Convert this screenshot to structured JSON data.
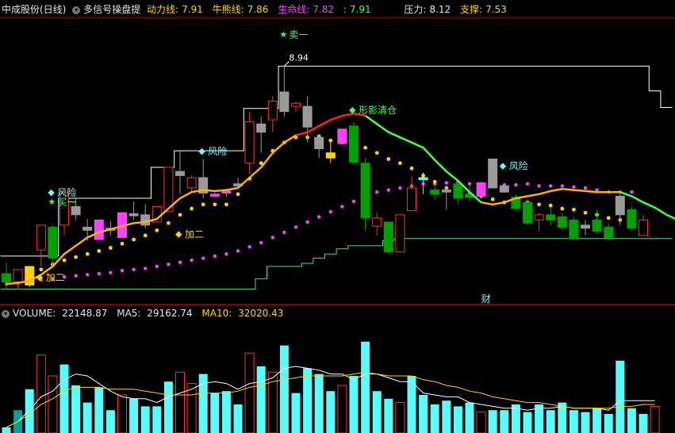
{
  "header": {
    "stock": "中成股份(日线)",
    "indicator": "多信号操盘提",
    "items": [
      {
        "label": "动力线:",
        "value": "7.91",
        "color": "#ffd400"
      },
      {
        "label": "牛熊线:",
        "value": "7.86",
        "color": "#ffd400"
      },
      {
        "label": "生命线:",
        "value": "7.82",
        "color": "#ff40ff"
      },
      {
        "label": ":",
        "value": "7.91",
        "color": "#44ff44"
      },
      {
        "label": "压力:",
        "value": "8.12",
        "color": "#e6e6e6"
      },
      {
        "label": "支撑:",
        "value": "7.53",
        "color": "#ffd400"
      }
    ]
  },
  "volume_header": {
    "label": "VOLUME:",
    "value": "22148.87",
    "ma5_label": "MA5:",
    "ma5": "29162.74",
    "ma10_label": "MA10:",
    "ma10": "32020.43"
  },
  "colors": {
    "up": "#ff3030",
    "down": "#00a000",
    "grey": "#9a9a9a",
    "magenta": "#ff40ff",
    "yellow": "#ffd400",
    "green": "#44ff44",
    "cyan": "#55ffff",
    "red": "#ff2020",
    "white": "#ffffff",
    "support": "#40e080",
    "divider": "#b00000"
  },
  "chart_data": [
    {
      "type": "candlestick",
      "ylim": [
        6.7,
        9.35
      ],
      "max_label": "8.94",
      "candles": [
        {
          "o": 6.93,
          "h": 7.04,
          "l": 6.78,
          "c": 6.85,
          "k": "down"
        },
        {
          "o": 6.85,
          "h": 6.97,
          "l": 6.78,
          "c": 6.97,
          "k": "up"
        },
        {
          "o": 6.82,
          "h": 7.0,
          "l": 6.8,
          "c": 7.0,
          "k": "yellow"
        },
        {
          "o": 7.16,
          "h": 7.4,
          "l": 7.0,
          "c": 7.4,
          "k": "up"
        },
        {
          "o": 7.38,
          "h": 7.4,
          "l": 7.0,
          "c": 7.08,
          "k": "down"
        },
        {
          "o": 7.4,
          "h": 7.72,
          "l": 7.3,
          "c": 7.72,
          "k": "up"
        },
        {
          "o": 7.58,
          "h": 7.66,
          "l": 7.45,
          "c": 7.5,
          "k": "grey"
        },
        {
          "o": 7.35,
          "h": 7.46,
          "l": 7.25,
          "c": 7.38,
          "k": "grey"
        },
        {
          "o": 7.26,
          "h": 7.45,
          "l": 7.26,
          "c": 7.45,
          "k": "magenta"
        },
        {
          "o": 7.35,
          "h": 7.44,
          "l": 7.3,
          "c": 7.37,
          "k": "grey"
        },
        {
          "o": 7.28,
          "h": 7.52,
          "l": 7.28,
          "c": 7.52,
          "k": "magenta"
        },
        {
          "o": 7.51,
          "h": 7.63,
          "l": 7.45,
          "c": 7.49,
          "k": "grey"
        },
        {
          "o": 7.5,
          "h": 7.6,
          "l": 7.37,
          "c": 7.4,
          "k": "grey"
        },
        {
          "o": 7.43,
          "h": 7.58,
          "l": 7.43,
          "c": 7.58,
          "k": "up"
        },
        {
          "o": 7.53,
          "h": 7.96,
          "l": 7.53,
          "c": 7.96,
          "k": "up"
        },
        {
          "o": 7.88,
          "h": 8.12,
          "l": 7.7,
          "c": 7.92,
          "k": "grey"
        },
        {
          "o": 7.76,
          "h": 7.88,
          "l": 7.73,
          "c": 7.86,
          "k": "up"
        },
        {
          "o": 7.86,
          "h": 8.04,
          "l": 7.66,
          "c": 7.71,
          "k": "grey"
        },
        {
          "o": 7.68,
          "h": 7.72,
          "l": 7.67,
          "c": 7.7,
          "k": "magenta"
        },
        {
          "o": 7.71,
          "h": 7.74,
          "l": 7.67,
          "c": 7.73,
          "k": "magenta"
        },
        {
          "o": 7.8,
          "h": 7.86,
          "l": 7.75,
          "c": 7.78,
          "k": "grey"
        },
        {
          "o": 8.0,
          "h": 8.5,
          "l": 7.9,
          "c": 8.4,
          "k": "up"
        },
        {
          "o": 8.3,
          "h": 8.45,
          "l": 8.1,
          "c": 8.38,
          "k": "grey"
        },
        {
          "o": 8.42,
          "h": 8.65,
          "l": 8.3,
          "c": 8.6,
          "k": "up"
        },
        {
          "o": 8.5,
          "h": 8.94,
          "l": 8.45,
          "c": 8.69,
          "k": "grey"
        },
        {
          "o": 8.55,
          "h": 8.6,
          "l": 8.5,
          "c": 8.58,
          "k": "up"
        },
        {
          "o": 8.55,
          "h": 8.65,
          "l": 8.2,
          "c": 8.35,
          "k": "grey"
        },
        {
          "o": 8.25,
          "h": 8.28,
          "l": 8.05,
          "c": 8.14,
          "k": "grey"
        },
        {
          "o": 8.1,
          "h": 8.22,
          "l": 8.0,
          "c": 8.05,
          "k": "yellow"
        },
        {
          "o": 8.19,
          "h": 8.33,
          "l": 8.19,
          "c": 8.33,
          "k": "magenta"
        },
        {
          "o": 8.36,
          "h": 8.4,
          "l": 7.99,
          "c": 8.01,
          "k": "down"
        },
        {
          "o": 8.0,
          "h": 8.05,
          "l": 7.35,
          "c": 7.47,
          "k": "down"
        },
        {
          "o": 7.39,
          "h": 7.52,
          "l": 7.3,
          "c": 7.47,
          "k": "up"
        },
        {
          "o": 7.43,
          "h": 7.43,
          "l": 7.12,
          "c": 7.14,
          "k": "down"
        },
        {
          "o": 7.14,
          "h": 7.5,
          "l": 7.14,
          "c": 7.5,
          "k": "up"
        },
        {
          "o": 7.54,
          "h": 7.87,
          "l": 7.54,
          "c": 7.76,
          "k": "up"
        },
        {
          "o": 7.84,
          "h": 7.91,
          "l": 7.7,
          "c": 7.86,
          "k": "cyan"
        },
        {
          "o": 7.74,
          "h": 7.78,
          "l": 7.65,
          "c": 7.7,
          "k": "down"
        },
        {
          "o": 7.74,
          "h": 7.78,
          "l": 7.55,
          "c": 7.72,
          "k": "grey"
        },
        {
          "o": 7.8,
          "h": 7.82,
          "l": 7.6,
          "c": 7.66,
          "k": "down"
        },
        {
          "o": 7.7,
          "h": 7.8,
          "l": 7.63,
          "c": 7.67,
          "k": "down"
        },
        {
          "o": 7.68,
          "h": 7.81,
          "l": 7.66,
          "c": 7.81,
          "k": "magenta"
        },
        {
          "o": 7.76,
          "h": 8.04,
          "l": 7.76,
          "c": 8.04,
          "k": "grey"
        },
        {
          "o": 7.78,
          "h": 7.78,
          "l": 7.72,
          "c": 7.72,
          "k": "grey"
        },
        {
          "o": 7.67,
          "h": 7.7,
          "l": 7.54,
          "c": 7.56,
          "k": "down"
        },
        {
          "o": 7.62,
          "h": 7.65,
          "l": 7.4,
          "c": 7.42,
          "k": "down"
        },
        {
          "o": 7.45,
          "h": 7.52,
          "l": 7.34,
          "c": 7.5,
          "k": "up"
        },
        {
          "o": 7.5,
          "h": 7.57,
          "l": 7.4,
          "c": 7.45,
          "k": "down"
        },
        {
          "o": 7.48,
          "h": 7.52,
          "l": 7.35,
          "c": 7.38,
          "k": "down"
        },
        {
          "o": 7.45,
          "h": 7.48,
          "l": 7.25,
          "c": 7.27,
          "k": "down"
        },
        {
          "o": 7.4,
          "h": 7.45,
          "l": 7.3,
          "c": 7.37,
          "k": "grey"
        },
        {
          "o": 7.45,
          "h": 7.55,
          "l": 7.32,
          "c": 7.34,
          "k": "down"
        },
        {
          "o": 7.38,
          "h": 7.42,
          "l": 7.25,
          "c": 7.28,
          "k": "down"
        },
        {
          "o": 7.5,
          "h": 7.7,
          "l": 7.4,
          "c": 7.68,
          "k": "grey"
        },
        {
          "o": 7.55,
          "h": 7.58,
          "l": 7.35,
          "c": 7.37,
          "k": "down"
        },
        {
          "o": 7.3,
          "h": 7.5,
          "l": 7.3,
          "c": 7.45,
          "k": "up"
        }
      ],
      "yellow_line": [
        6.83,
        6.84,
        6.86,
        6.92,
        7.0,
        7.12,
        7.2,
        7.28,
        7.33,
        7.36,
        7.39,
        7.42,
        7.43,
        7.46,
        7.56,
        7.66,
        7.72,
        7.74,
        7.73,
        7.74,
        7.76,
        7.86,
        7.96,
        8.1,
        8.2,
        8.27
      ],
      "red_line": [
        8.27,
        8.3,
        8.36,
        8.42,
        8.46,
        8.48,
        8.46
      ],
      "green_line": [
        8.46,
        8.38,
        8.3,
        8.25,
        8.2,
        8.15,
        8.03,
        7.92,
        7.83,
        7.72,
        7.62
      ],
      "yellow_line2": [
        7.62,
        7.6,
        7.62,
        7.66,
        7.68,
        7.7,
        7.73,
        7.75,
        7.74,
        7.73,
        7.72,
        7.72,
        7.72
      ],
      "green_line2": [
        7.72,
        7.68,
        7.62,
        7.57,
        7.5,
        7.45
      ],
      "yellow_line3": [
        7.45,
        7.44,
        7.44,
        7.42,
        7.4,
        7.4,
        7.39,
        7.4,
        7.38,
        7.4
      ],
      "yellow_dots": [
        6.86,
        6.88,
        6.92,
        6.97,
        7.02,
        7.06,
        7.09,
        7.12,
        7.15,
        7.18,
        7.22,
        7.26,
        7.3,
        7.35,
        7.42,
        7.5,
        7.56,
        7.6,
        7.6,
        7.6,
        7.7,
        7.85,
        8.0,
        8.12,
        8.2,
        8.25,
        8.25,
        8.26,
        8.22,
        8.2,
        8.2,
        8.15,
        8.1,
        8.04,
        8.0,
        7.95,
        7.88,
        7.82,
        7.76,
        7.72,
        7.7,
        7.68,
        7.65,
        7.62,
        7.6,
        7.62,
        7.6,
        7.59,
        7.56,
        7.55,
        7.52,
        7.5,
        7.47,
        7.45,
        7.42,
        7.38
      ],
      "magenta_dots": [
        6.83,
        6.84,
        6.85,
        6.87,
        6.88,
        6.9,
        6.91,
        6.92,
        6.93,
        6.94,
        6.96,
        6.97,
        6.98,
        7.0,
        7.02,
        7.04,
        7.06,
        7.08,
        7.1,
        7.12,
        7.15,
        7.19,
        7.23,
        7.28,
        7.33,
        7.38,
        7.43,
        7.48,
        7.53,
        7.58,
        7.63,
        7.68,
        7.72,
        7.74,
        7.76,
        7.78,
        7.8,
        7.8,
        7.81,
        7.82,
        7.8,
        7.8,
        7.8,
        7.79,
        7.79,
        7.8,
        7.78,
        7.78,
        7.78,
        7.77,
        7.76,
        7.74,
        7.72,
        7.72,
        7.72
      ],
      "resistance": [
        7.1,
        7.1,
        7.1,
        7.1,
        7.1,
        7.66,
        7.66,
        7.66,
        7.66,
        7.66,
        7.66,
        7.66,
        7.66,
        7.96,
        7.96,
        8.12,
        8.12,
        8.12,
        8.12,
        8.12,
        8.12,
        8.53,
        8.53,
        8.53,
        8.94,
        8.94,
        8.94,
        8.94,
        8.94,
        8.94,
        8.94,
        8.94,
        8.94,
        8.94,
        8.94,
        8.94,
        8.94,
        8.94,
        8.94,
        8.94,
        8.94,
        8.94,
        8.94,
        8.94,
        8.94,
        8.94,
        8.94,
        8.94,
        8.94,
        8.94,
        8.94,
        8.94,
        8.94,
        8.94,
        8.94,
        8.94,
        8.7,
        8.54
      ],
      "support": [
        6.78,
        6.78,
        6.78,
        6.78,
        6.78,
        6.78,
        6.78,
        6.78,
        6.78,
        6.78,
        6.78,
        6.78,
        6.78,
        6.78,
        6.78,
        6.78,
        6.78,
        6.78,
        6.78,
        6.78,
        6.78,
        6.78,
        6.88,
        7.0,
        7.0,
        7.0,
        7.03,
        7.08,
        7.12,
        7.17,
        7.2,
        7.2,
        7.2,
        7.25,
        7.27,
        7.27,
        7.27,
        7.27,
        7.27,
        7.27,
        7.27,
        7.27,
        7.27,
        7.27,
        7.27,
        7.27,
        7.27,
        7.27,
        7.27,
        7.27,
        7.27,
        7.27,
        7.27,
        7.27,
        7.27,
        7.27,
        7.27,
        7.27
      ],
      "signals": [
        {
          "idx": 4,
          "text": "风险",
          "kind": "diamond",
          "color": "#66ffff",
          "price": 7.72
        },
        {
          "idx": 4,
          "text": "买一",
          "kind": "star",
          "color": "#44ff44",
          "price": 7.63
        },
        {
          "idx": 3,
          "text": "加二",
          "kind": "diamond",
          "color": "#ffd400",
          "price": 6.9
        },
        {
          "idx": 15,
          "text": "加二",
          "kind": "diamond",
          "color": "#ffd400",
          "price": 7.32
        },
        {
          "idx": 17,
          "text": "风险",
          "kind": "diamond",
          "color": "#66ffff",
          "price": 8.12
        },
        {
          "idx": 24,
          "text": "卖一",
          "kind": "star",
          "color": "#44ff44",
          "price": 9.25
        },
        {
          "idx": 30,
          "text": "形影清仓",
          "kind": "diamond",
          "color": "#44ff44",
          "price": 8.52
        },
        {
          "idx": 43,
          "text": "风险",
          "kind": "diamond",
          "color": "#66ffff",
          "price": 7.98
        }
      ],
      "annotations": [
        {
          "text": "财",
          "idx": 41,
          "color": "#66ffff"
        }
      ]
    },
    {
      "type": "bar",
      "name": "VOLUME",
      "ylim": [
        0,
        60000
      ],
      "values": [
        3000,
        12000,
        23000,
        41000,
        30000,
        36000,
        25000,
        16000,
        24000,
        12000,
        20000,
        18000,
        14000,
        14000,
        27000,
        32000,
        26000,
        31000,
        21000,
        22000,
        15000,
        42000,
        35000,
        32000,
        46000,
        21000,
        34000,
        31000,
        22000,
        25000,
        30000,
        48000,
        22000,
        18000,
        16000,
        30000,
        20000,
        15000,
        17000,
        14000,
        16000,
        11000,
        12000,
        12000,
        15000,
        11000,
        15000,
        12000,
        16000,
        12000,
        11000,
        13000,
        10000,
        38000,
        13000,
        10000,
        14000
      ],
      "kinds": [
        "c",
        "d",
        "c",
        "u",
        "u",
        "c",
        "c",
        "c",
        "c",
        "c",
        "u",
        "c",
        "c",
        "c",
        "c",
        "u",
        "u",
        "c",
        "c",
        "c",
        "c",
        "u",
        "c",
        "u",
        "c",
        "c",
        "c",
        "c",
        "c",
        "u",
        "c",
        "c",
        "c",
        "c",
        "u",
        "c",
        "c",
        "c",
        "c",
        "c",
        "c",
        "u",
        "c",
        "c",
        "c",
        "c",
        "c",
        "c",
        "c",
        "c",
        "c",
        "c",
        "c",
        "c",
        "c",
        "c",
        "u"
      ],
      "ma5": [
        3000,
        6000,
        12000,
        19000,
        22000,
        28000,
        31000,
        30000,
        26000,
        22000,
        19000,
        18000,
        18000,
        16000,
        19000,
        21000,
        23000,
        26000,
        27000,
        26000,
        23000,
        26000,
        27000,
        29000,
        34000,
        35000,
        34000,
        33000,
        31000,
        31000,
        28000,
        31000,
        31000,
        29000,
        27000,
        27000,
        21000,
        20000,
        19000,
        19000,
        16000,
        15000,
        14000,
        13000,
        13000,
        12000,
        13000,
        13000,
        14000,
        13000,
        13000,
        13000,
        12000,
        17000,
        17000,
        17000,
        17000
      ],
      "ma10": [
        3000,
        6000,
        10000,
        15000,
        18000,
        22000,
        24000,
        24000,
        24000,
        23000,
        23000,
        23000,
        22000,
        21000,
        20000,
        20000,
        20000,
        21000,
        21000,
        21000,
        22000,
        24000,
        25000,
        27000,
        28000,
        29000,
        30000,
        30000,
        30000,
        30000,
        31000,
        32000,
        31000,
        30000,
        30000,
        30000,
        28000,
        27000,
        25000,
        24000,
        22000,
        21000,
        19000,
        18000,
        17000,
        16000,
        16000,
        15000,
        14000,
        13000,
        13000,
        13000,
        13000,
        14000,
        14000,
        15000,
        15000
      ]
    }
  ]
}
